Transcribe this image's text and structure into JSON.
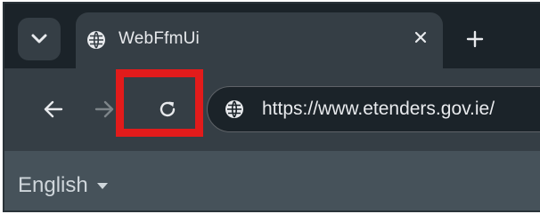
{
  "tab": {
    "title": "WebFfmUi",
    "close_glyph": "×",
    "favicon_icon": "globe-icon"
  },
  "tabstrip": {
    "search_icon": "chevron-down-icon",
    "new_tab_glyph": "+"
  },
  "toolbar": {
    "back_icon": "arrow-left-icon",
    "forward_icon": "arrow-right-icon",
    "reload_icon": "reload-icon",
    "highlight_color": "#e21b1b"
  },
  "omnibox": {
    "url": "https://www.etenders.gov.ie/",
    "site_icon": "globe-icon"
  },
  "page": {
    "language": "English",
    "language_caret_icon": "caret-down-icon"
  },
  "colors": {
    "tabstrip_bg": "#1b2329",
    "toolbar_bg": "#353e45",
    "page_bg": "#46525a",
    "text": "#e8eaed"
  }
}
